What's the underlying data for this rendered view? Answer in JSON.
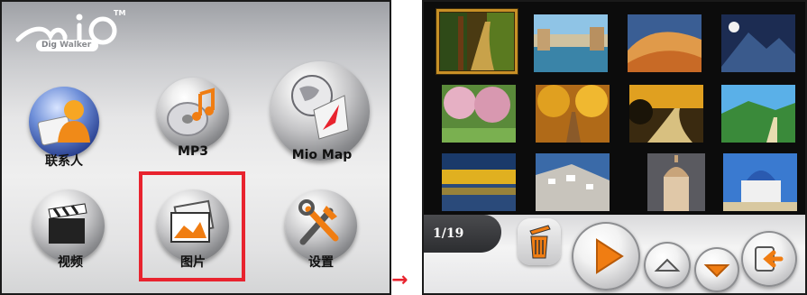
{
  "logo": {
    "brand": "Mio",
    "trademark": "TM",
    "subtitle_a": "Dig",
    "subtitle_b": "Walker"
  },
  "home": {
    "buttons": [
      {
        "label": "联系人",
        "icon": "contacts-icon"
      },
      {
        "label": "MP3",
        "icon": "mp3-disc-icon"
      },
      {
        "label": "Mio Map",
        "icon": "globe-map-icon"
      },
      {
        "label": "视频",
        "icon": "clapperboard-icon"
      },
      {
        "label": "图片",
        "icon": "pictures-icon"
      },
      {
        "label": "设置",
        "icon": "tools-icon"
      }
    ],
    "highlighted": "图片"
  },
  "arrow": "→",
  "viewer": {
    "counter": "1/19",
    "thumbnails": [
      "forest-path",
      "river-town",
      "desert-dunes",
      "mountain-moon",
      "cherry-blossom-trees",
      "autumn-avenue",
      "sunset-road",
      "green-mountain-path",
      "lake-autumn-reflection",
      "cliff-village",
      "church-dome",
      "white-chapel"
    ],
    "selected_index": 0,
    "controls": [
      "delete-icon",
      "play-icon",
      "up-arrow-icon",
      "down-arrow-icon",
      "back-icon"
    ]
  },
  "colors": {
    "highlight": "#e8232e",
    "accent": "#f07d12",
    "selection": "#c89026"
  }
}
